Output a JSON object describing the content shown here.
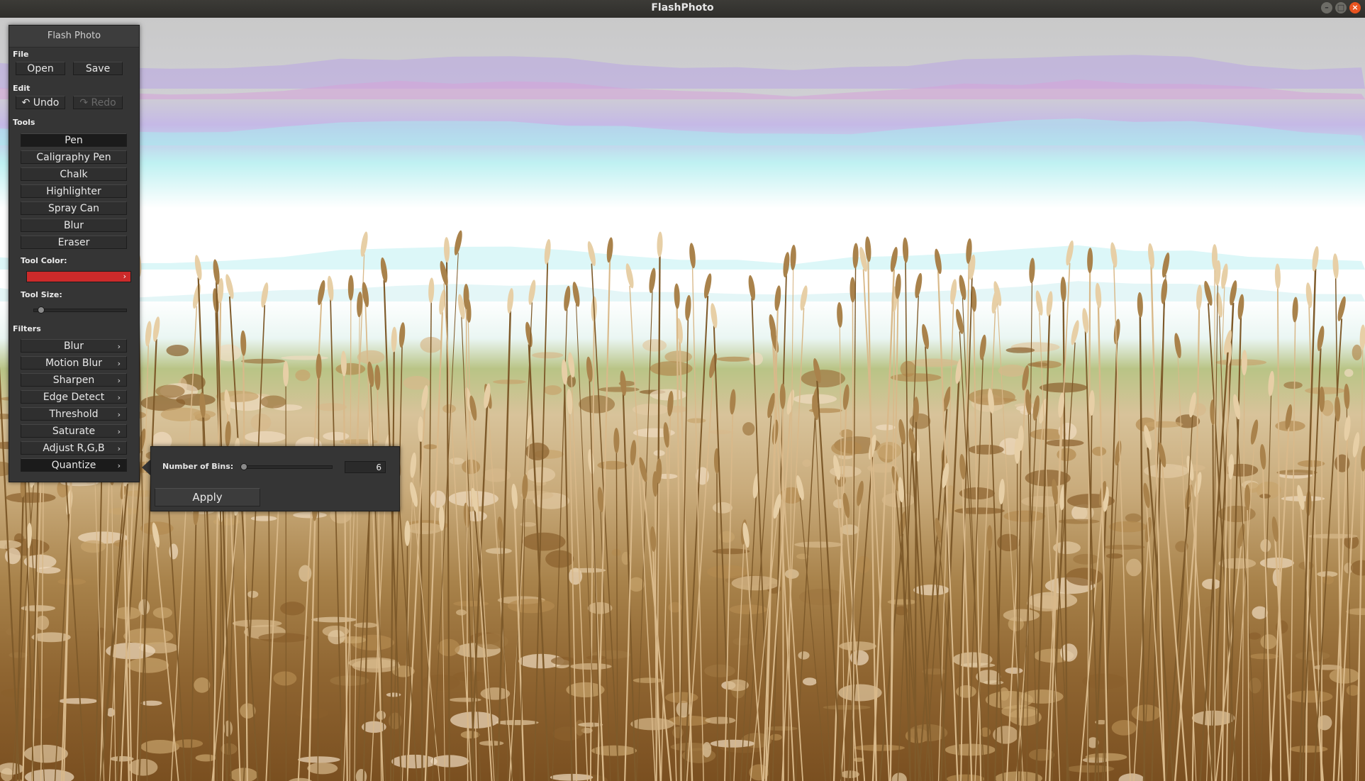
{
  "window": {
    "title": "FlashPhoto",
    "controls": [
      "minimize-icon",
      "maximize-icon",
      "close-icon"
    ]
  },
  "panel": {
    "title": "Flash Photo",
    "file": {
      "label": "File",
      "open": "Open",
      "save": "Save"
    },
    "edit": {
      "label": "Edit",
      "undo": "Undo",
      "redo": "Redo"
    },
    "tools": {
      "label": "Tools",
      "items": [
        "Pen",
        "Caligraphy Pen",
        "Chalk",
        "Highlighter",
        "Spray Can",
        "Blur",
        "Eraser"
      ],
      "selected": "Pen",
      "tool_color_label": "Tool Color:",
      "tool_color": "#cc2a2a",
      "tool_size_label": "Tool Size:",
      "tool_size_fraction": 0.08
    },
    "filters": {
      "label": "Filters",
      "items": [
        "Blur",
        "Motion Blur",
        "Sharpen",
        "Edge Detect",
        "Threshold",
        "Saturate",
        "Adjust R,G,B",
        "Quantize"
      ],
      "selected": "Quantize"
    }
  },
  "quantize_popup": {
    "bins_label": "Number of Bins:",
    "bins_value": "6",
    "bins_fraction": 0.02,
    "apply_label": "Apply"
  }
}
